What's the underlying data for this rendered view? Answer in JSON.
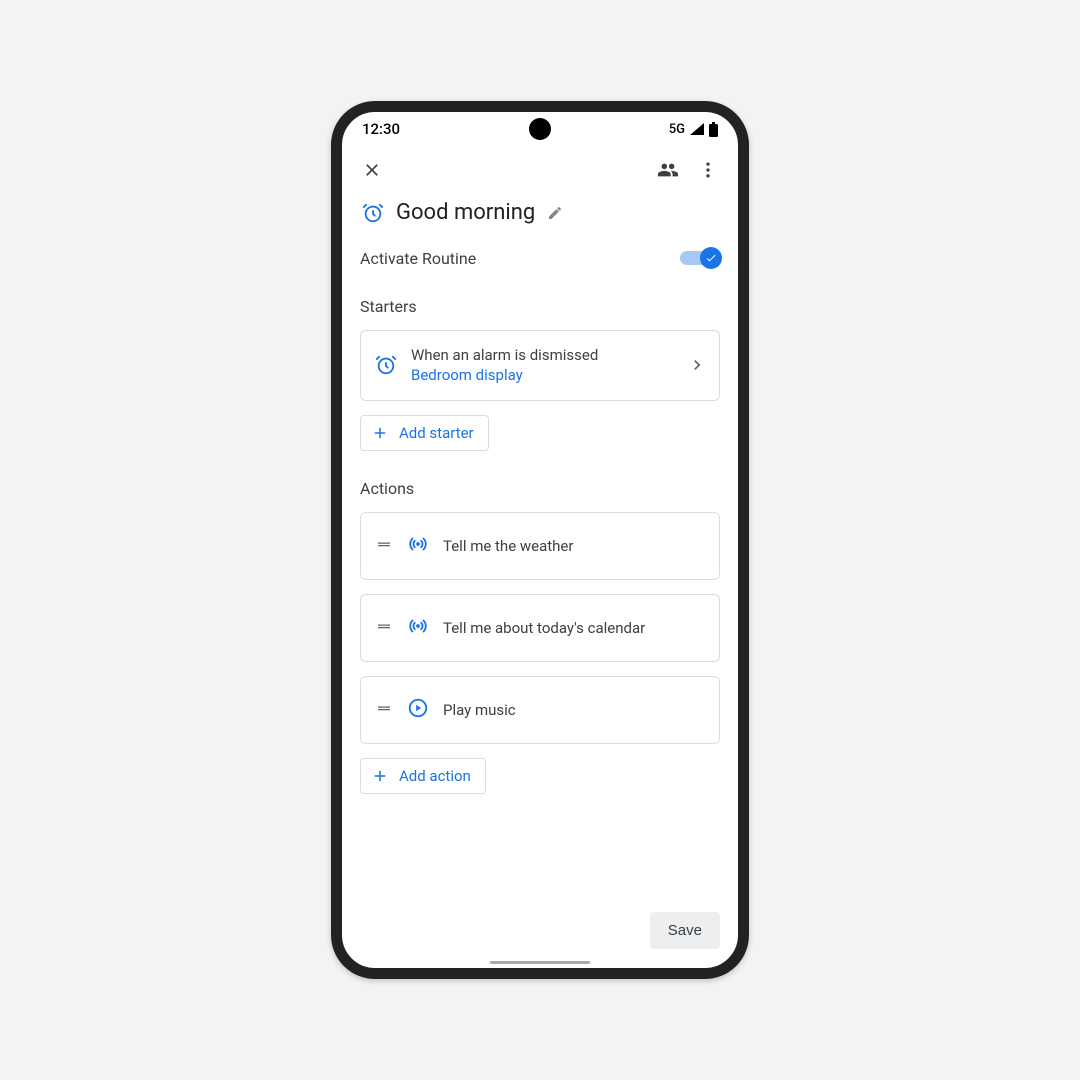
{
  "status": {
    "time": "12:30",
    "network": "5G"
  },
  "routine": {
    "title": "Good morning",
    "activate_label": "Activate Routine",
    "activated": true
  },
  "sections": {
    "starters_heading": "Starters",
    "actions_heading": "Actions"
  },
  "starters": [
    {
      "title": "When an alarm is dismissed",
      "subtitle": "Bedroom display"
    }
  ],
  "starters_add_label": "Add starter",
  "actions": [
    {
      "icon": "broadcast",
      "label": "Tell me the weather"
    },
    {
      "icon": "broadcast",
      "label": "Tell me about today's calendar"
    },
    {
      "icon": "play",
      "label": "Play music"
    }
  ],
  "actions_add_label": "Add action",
  "save_label": "Save"
}
